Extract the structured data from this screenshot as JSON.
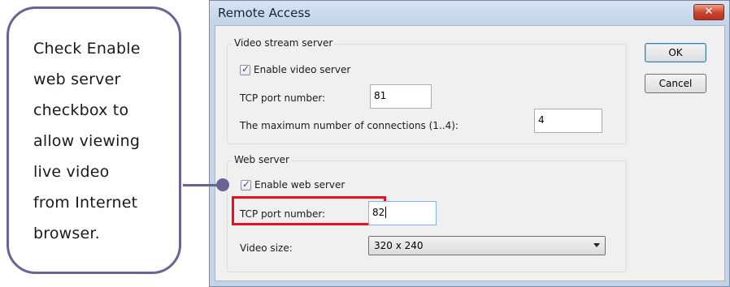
{
  "callout": {
    "lines": [
      "Check Enable",
      "web server",
      "checkbox to",
      "allow viewing",
      "live video",
      "from Internet",
      "browser."
    ],
    "border_color": "#6a6396"
  },
  "dialog": {
    "title": "Remote Access",
    "close_icon": "close-icon",
    "buttons": {
      "ok": "OK",
      "cancel": "Cancel"
    },
    "video_stream": {
      "group_label": "Video stream server",
      "enable_label": "Enable video server",
      "enable_checked": true,
      "port_label": "TCP port number:",
      "port_value": "81",
      "max_label": "The maximum number of connections (1..4):",
      "max_value": "4"
    },
    "web_server": {
      "group_label": "Web server",
      "enable_label": "Enable web server",
      "enable_checked": true,
      "port_label": "TCP port number:",
      "port_value": "82",
      "size_label": "Video size:",
      "size_value": "320 x 240"
    },
    "highlight_color": "#e8101f"
  }
}
